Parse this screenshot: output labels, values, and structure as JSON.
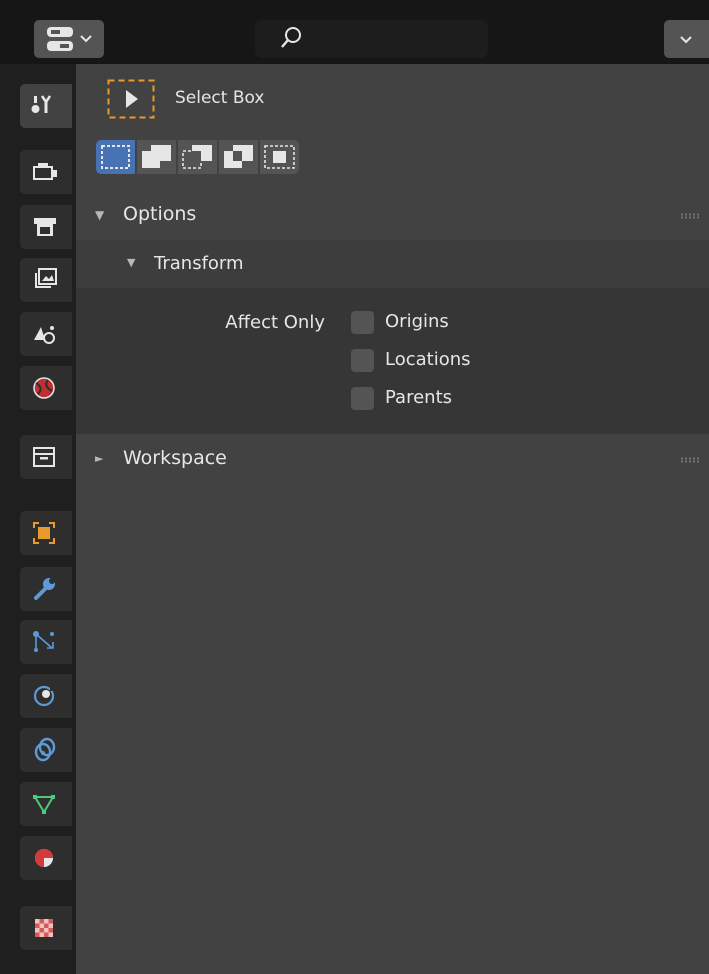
{
  "header": {
    "editor_type_icon": "properties-editor-icon",
    "search": {
      "placeholder": "",
      "value": ""
    }
  },
  "tabs": [
    {
      "name": "tool",
      "icon": "tool-icon",
      "active": true
    },
    {
      "name": "render",
      "icon": "render-icon"
    },
    {
      "name": "output",
      "icon": "output-icon"
    },
    {
      "name": "view-layer",
      "icon": "view-layer-icon"
    },
    {
      "name": "scene",
      "icon": "scene-icon"
    },
    {
      "name": "world",
      "icon": "world-icon"
    },
    {
      "name": "collection",
      "icon": "collection-icon"
    },
    {
      "name": "object",
      "icon": "object-icon"
    },
    {
      "name": "modifiers",
      "icon": "wrench-icon"
    },
    {
      "name": "particles",
      "icon": "particles-icon"
    },
    {
      "name": "physics",
      "icon": "physics-icon"
    },
    {
      "name": "constraints",
      "icon": "constraints-icon"
    },
    {
      "name": "data",
      "icon": "mesh-data-icon"
    },
    {
      "name": "material",
      "icon": "material-icon"
    },
    {
      "name": "texture",
      "icon": "texture-icon"
    }
  ],
  "tool": {
    "name": "Select Box",
    "icon": "select-box-icon",
    "modes": [
      "set",
      "extend",
      "subtract",
      "invert",
      "intersect"
    ],
    "active_mode": "set"
  },
  "panels": {
    "options": {
      "label": "Options",
      "expanded": true
    },
    "transform": {
      "label": "Transform",
      "expanded": true
    },
    "workspace": {
      "label": "Workspace",
      "expanded": false
    }
  },
  "affect_only": {
    "label": "Affect Only",
    "items": [
      {
        "label": "Origins",
        "checked": false
      },
      {
        "label": "Locations",
        "checked": false
      },
      {
        "label": "Parents",
        "checked": false
      }
    ]
  },
  "colors": {
    "accent": "#4772b3",
    "tool_outline": "#e89a2c"
  }
}
